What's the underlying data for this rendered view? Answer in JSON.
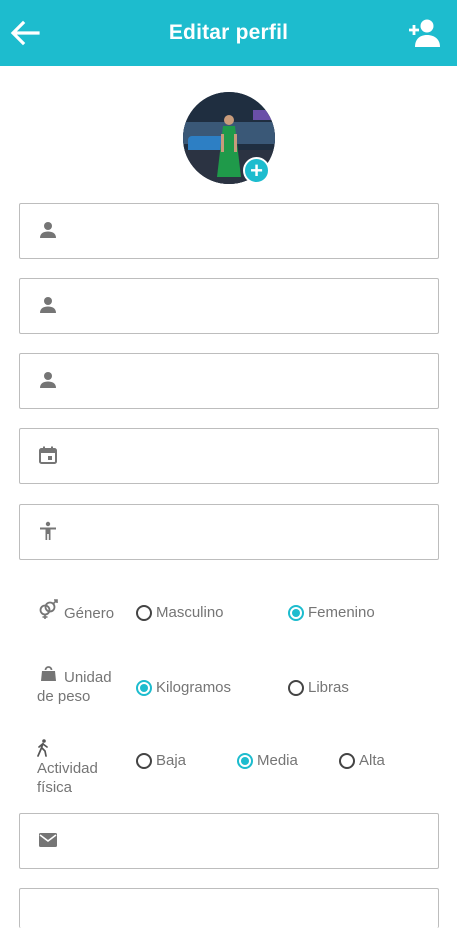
{
  "header": {
    "title": "Editar perfil",
    "back_icon": "arrow-left-icon",
    "action_icon": "person-add-icon"
  },
  "accent_color": "#1DBCCE",
  "fields": {
    "first_name": {
      "icon": "person-icon",
      "value": ""
    },
    "last_name": {
      "icon": "person-icon",
      "value": ""
    },
    "username": {
      "icon": "person-icon",
      "value": ""
    },
    "birthdate": {
      "icon": "calendar-icon",
      "value": ""
    },
    "height": {
      "icon": "accessibility-icon",
      "value": ""
    },
    "email": {
      "icon": "mail-icon",
      "value": ""
    }
  },
  "gender": {
    "label": "Género",
    "options": [
      "Masculino",
      "Femenino"
    ],
    "selected": "Femenino"
  },
  "weight_unit": {
    "label_line1": "Unidad",
    "label_line2": "de peso",
    "options": [
      "Kilogramos",
      "Libras"
    ],
    "selected": "Kilogramos"
  },
  "activity": {
    "label_line1": "Actividad",
    "label_line2": "física",
    "options": [
      "Baja",
      "Media",
      "Alta"
    ],
    "selected": "Media"
  }
}
